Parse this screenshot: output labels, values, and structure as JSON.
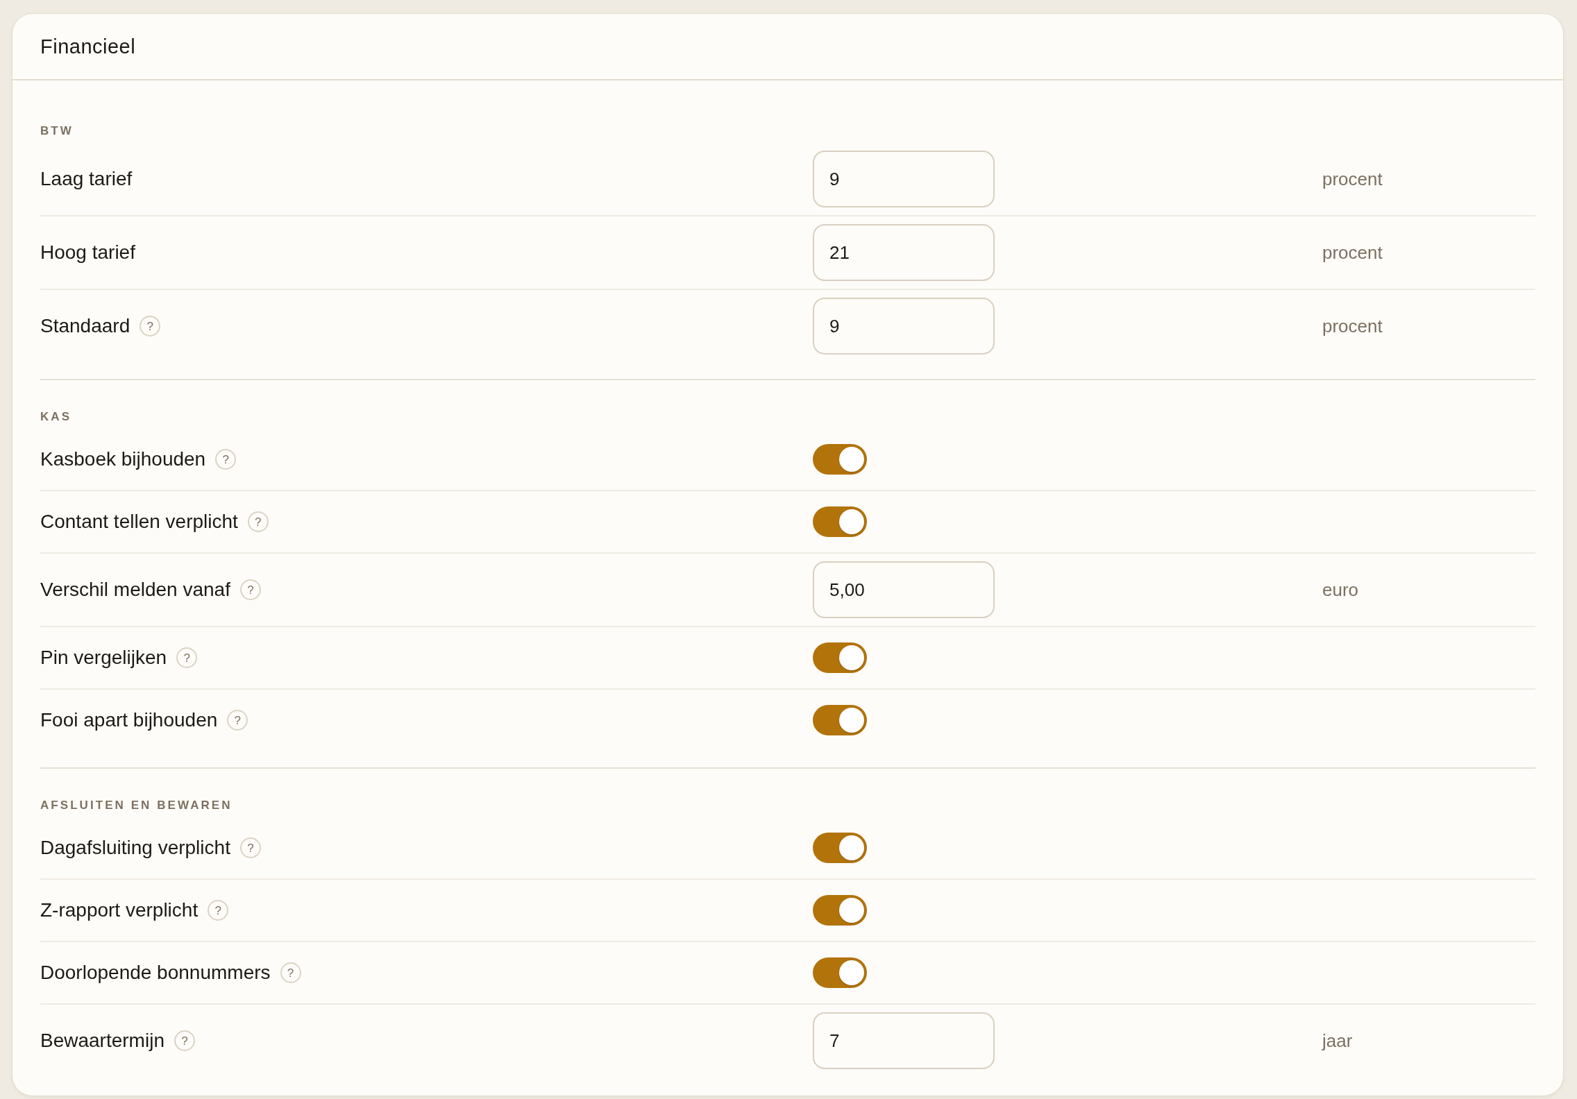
{
  "panel": {
    "title": "Financieel"
  },
  "sections": [
    {
      "title": "BTW",
      "settings": [
        {
          "kind": "number",
          "label": "Laag tarief",
          "value": "9",
          "unit": "procent"
        },
        {
          "kind": "number",
          "label": "Hoog tarief",
          "value": "21",
          "unit": "procent"
        },
        {
          "kind": "number",
          "label": "Standaard",
          "help": "?",
          "value": "9",
          "unit": "procent"
        }
      ]
    },
    {
      "title": "KAS",
      "settings": [
        {
          "kind": "toggle",
          "label": "Kasboek bijhouden",
          "help": "?",
          "on": true
        },
        {
          "kind": "toggle",
          "label": "Contant tellen verplicht",
          "help": "?",
          "on": true
        },
        {
          "kind": "number",
          "label": "Verschil melden vanaf",
          "help": "?",
          "value": "5,00",
          "unit": "euro"
        },
        {
          "kind": "toggle",
          "label": "Pin vergelijken",
          "help": "?",
          "on": true
        },
        {
          "kind": "toggle",
          "label": "Fooi apart bijhouden",
          "help": "?",
          "on": true
        }
      ]
    },
    {
      "title": "AFSLUITEN EN BEWAREN",
      "settings": [
        {
          "kind": "toggle",
          "label": "Dagafsluiting verplicht",
          "help": "?",
          "on": true
        },
        {
          "kind": "toggle",
          "label": "Z-rapport verplicht",
          "help": "?",
          "on": true
        },
        {
          "kind": "toggle",
          "label": "Doorlopende bonnummers",
          "help": "?",
          "on": true
        },
        {
          "kind": "number",
          "label": "Bewaartermijn",
          "help": "?",
          "value": "7",
          "unit": "jaar"
        }
      ]
    }
  ]
}
